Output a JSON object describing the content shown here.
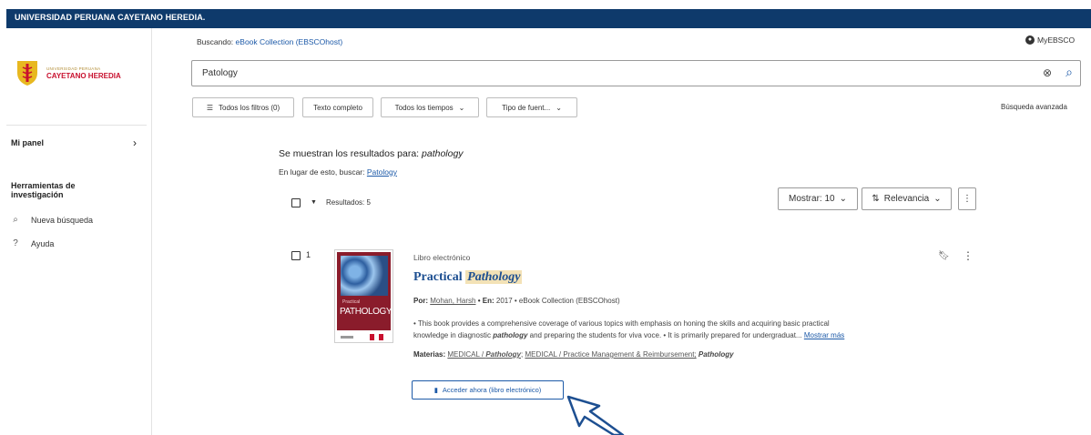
{
  "header": {
    "institution": "UNIVERSIDAD PERUANA CAYETANO HEREDIA."
  },
  "logo": {
    "small_text": "UNIVERSIDAD PERUANA",
    "name": "CAYETANO HEREDIA"
  },
  "sidebar": {
    "panel_label": "Mi panel",
    "tools_heading": "Herramientas de\ninvestigación",
    "items": [
      {
        "label": "Nueva búsqueda",
        "icon": "search-icon"
      },
      {
        "label": "Ayuda",
        "icon": "help-icon"
      }
    ]
  },
  "search": {
    "searching_label": "Buscando:",
    "source": "eBook Collection (EBSCOhost)",
    "query": "Patology",
    "myebsco": "MyEBSCO"
  },
  "filters": {
    "all_filters": "Todos los filtros (0)",
    "full_text": "Texto completo",
    "all_times": "Todos los tiempos",
    "source_type": "Tipo de fuent...",
    "advanced": "Búsqueda avanzada"
  },
  "results": {
    "showing_prefix": "Se muestran los resultados para:",
    "showing_term": "pathology",
    "instead_prefix": "En lugar de esto, buscar:",
    "instead_term": "Patology",
    "count_label": "Resultados: 5",
    "show_label": "Mostrar: 10",
    "sort_label": "Relevancia"
  },
  "item": {
    "index": "1",
    "type": "Libro electrónico",
    "title_prefix": "Practical",
    "title_highlight": "Pathology",
    "by_label": "Por:",
    "author": "Mohan, Harsh",
    "in_label": "• En:",
    "year": "2017",
    "collection": "• eBook Collection (EBSCOhost)",
    "desc_1": "• This book provides a comprehensive coverage of various topics with emphasis on honing the skills and acquiring basic practical",
    "desc_2a": "knowledge in diagnostic",
    "desc_2b": "pathology",
    "desc_2c": "and preparing the students for viva voce. • It is primarily prepared for undergraduat...",
    "more": "Mostrar más",
    "subjects_label": "Materias:",
    "subj_1a": "MEDICAL /",
    "subj_1b": "Pathology",
    "subj_2": "MEDICAL / Practice Management & Reimbursement;",
    "subj_3": "Pathology",
    "access_button": "Acceder ahora (libro electrónico)",
    "cover_small": "Practical",
    "cover_big": "PATHOLOGY"
  },
  "colors": {
    "brand_navy": "#0e3a6b",
    "link_blue": "#1d5aa8",
    "logo_red": "#c8102e"
  }
}
